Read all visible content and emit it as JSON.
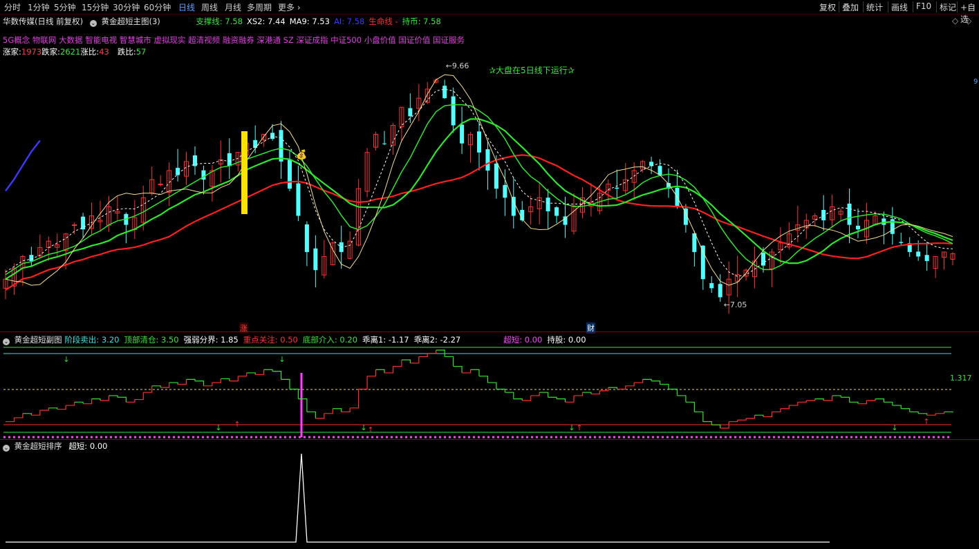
{
  "toolbar": {
    "periods": [
      "分时",
      "1分钟",
      "5分钟",
      "15分钟",
      "30分钟",
      "60分钟",
      "日线",
      "周线",
      "月线",
      "多周期",
      "更多"
    ],
    "active_index": 6,
    "right_tools": [
      "复权",
      "叠加",
      "统计",
      "画线",
      "F10",
      "标记",
      "+自选"
    ]
  },
  "main_panel": {
    "title": "华数传媒(日线 前复权)",
    "indicator_name": "黄金超短主图(3)",
    "values": [
      {
        "label": "支撑线: 7.58",
        "color": "#3ae63a"
      },
      {
        "label": "XS2: 7.44",
        "color": "#ffffff"
      },
      {
        "label": "MA9: 7.53",
        "color": "#ffffff"
      },
      {
        "label": "AI: 7.58",
        "color": "#3a3aff"
      },
      {
        "label": "生命线 -",
        "color": "#ff3030"
      },
      {
        "label": "持币: 7.58",
        "color": "#3ae63a"
      }
    ],
    "concepts": "5G概念 物联网 大数据 智能电视 智慧城市 虚拟现实 超清视频 融资融券 深港通 SZ 深证成指 中证500 小盘价值 国证价值 国证服务",
    "stats": [
      {
        "label": "涨家:",
        "value": "1973",
        "label_color": "#ffffff",
        "value_color": "#ff4040"
      },
      {
        "label": "跌家:",
        "value": "2621",
        "label_color": "#ffffff",
        "value_color": "#3ae63a"
      },
      {
        "label": "涨比:",
        "value": "43",
        "label_color": "#ffffff",
        "value_color": "#ff4040"
      },
      {
        "label": "跌比:",
        "value": "57",
        "label_color": "#ffffff",
        "value_color": "#3ae63a"
      }
    ],
    "banner": "✰大盘在5日线下运行✰",
    "high_label": "9.66",
    "low_label": "7.05",
    "price_tag": "9",
    "marker_zhang": "涨",
    "marker_cai": "财",
    "coin_icon": "money-bag-icon"
  },
  "sub_panel": {
    "name": "黄金超短副图",
    "values": [
      {
        "label": "阶段卖出: 3.20",
        "color": "#40e0e0"
      },
      {
        "label": "顶部清仓: 3.50",
        "color": "#3ae63a"
      },
      {
        "label": "强弱分界: 1.85",
        "color": "#ffffff"
      },
      {
        "label": "重点关注: 0.50",
        "color": "#ff3030"
      },
      {
        "label": "底部介入: 0.20",
        "color": "#3ae63a"
      },
      {
        "label": "乖离1: -1.17",
        "color": "#ffffff"
      },
      {
        "label": "乖离2: -2.27",
        "color": "#ffffff"
      },
      {
        "label": "超短: 0.00",
        "color": "#ff40ff"
      },
      {
        "label": "持股: 0.00",
        "color": "#ffffff"
      }
    ],
    "level_label": "1.317"
  },
  "rank_panel": {
    "name": "黄金超短排序",
    "value": "超短: 0.00"
  },
  "chart_data": {
    "type": "line",
    "title": "华数传媒(日线 前复权)",
    "series": [
      {
        "name": "支撑线",
        "last": 7.58
      },
      {
        "name": "XS2",
        "last": 7.44
      },
      {
        "name": "MA9",
        "last": 7.53
      },
      {
        "name": "AI",
        "last": 7.58
      },
      {
        "name": "持币",
        "last": 7.58
      }
    ],
    "price_high": 9.66,
    "price_low": 7.05,
    "close_series": [
      7.3,
      7.42,
      7.55,
      7.5,
      7.65,
      7.72,
      7.68,
      7.8,
      7.9,
      7.85,
      8.0,
      7.95,
      8.1,
      8.05,
      7.9,
      7.98,
      8.2,
      8.4,
      8.35,
      8.5,
      8.45,
      8.6,
      8.55,
      8.4,
      8.5,
      8.62,
      8.55,
      8.7,
      8.8,
      8.75,
      8.9,
      8.85,
      8.6,
      8.3,
      8.0,
      7.6,
      7.4,
      7.55,
      7.7,
      7.6,
      7.72,
      8.3,
      8.7,
      8.9,
      8.8,
      9.0,
      9.2,
      9.1,
      9.3,
      9.4,
      9.5,
      9.3,
      9.0,
      8.8,
      8.9,
      8.7,
      8.5,
      8.3,
      8.2,
      8.0,
      7.95,
      8.1,
      8.2,
      8.05,
      8.0,
      7.9,
      8.1,
      8.2,
      8.15,
      8.25,
      8.35,
      8.3,
      8.4,
      8.5,
      8.6,
      8.55,
      8.45,
      8.3,
      8.1,
      7.9,
      7.6,
      7.3,
      7.2,
      7.1,
      7.3,
      7.35,
      7.4,
      7.5,
      7.45,
      7.6,
      7.7,
      7.8,
      7.9,
      7.95,
      8.0,
      7.95,
      8.1,
      8.05,
      7.9,
      7.85,
      7.95,
      8.0,
      7.9,
      7.8,
      7.7,
      7.6,
      7.55,
      7.5,
      7.55,
      7.6,
      7.58
    ]
  }
}
